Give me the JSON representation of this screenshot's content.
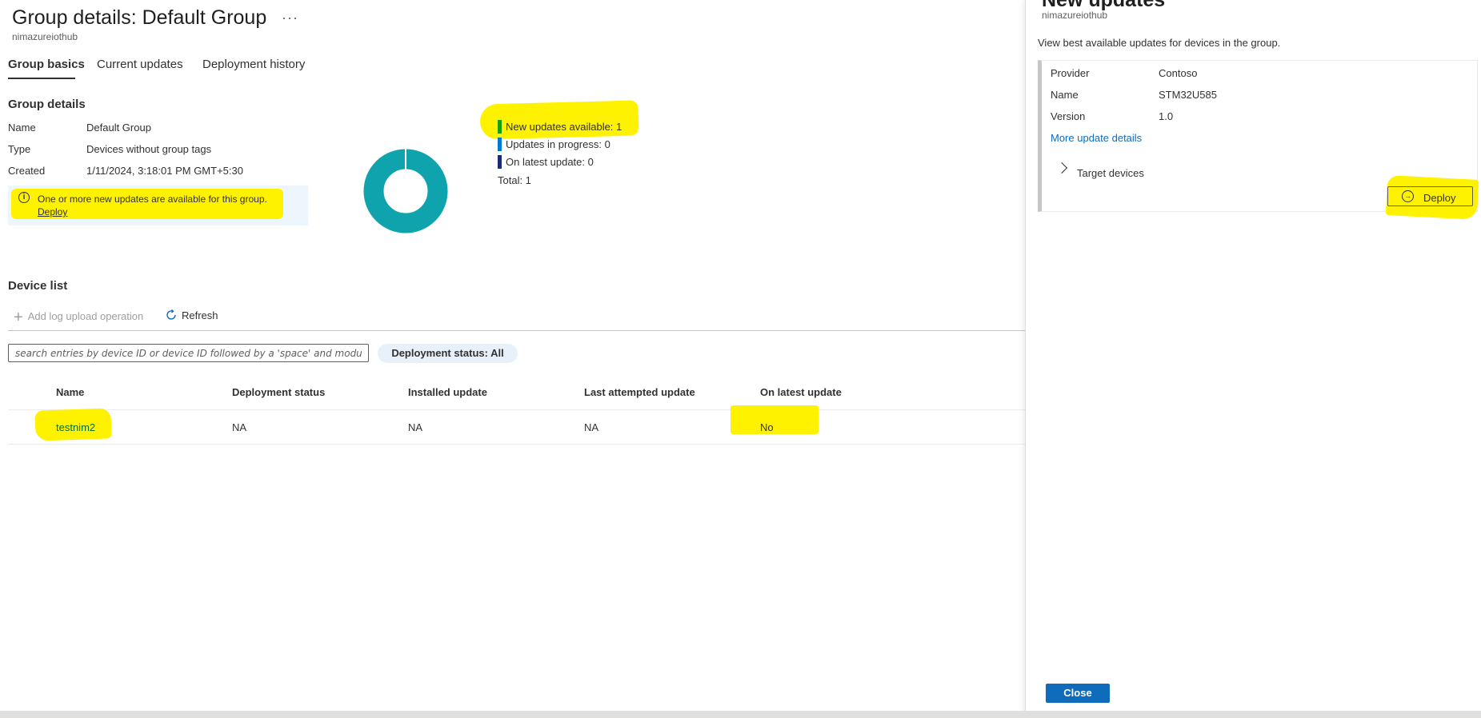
{
  "header": {
    "title": "Group details: Default Group",
    "more_label": "···",
    "subtitle": "nimazureiothub"
  },
  "tabs": [
    {
      "label": "Group basics",
      "active": true
    },
    {
      "label": "Current updates",
      "active": false
    },
    {
      "label": "Deployment history",
      "active": false
    }
  ],
  "group_details": {
    "title": "Group details",
    "rows": [
      {
        "key": "Name",
        "value": "Default Group"
      },
      {
        "key": "Type",
        "value": "Devices without group tags"
      },
      {
        "key": "Created",
        "value": "1/11/2024, 3:18:01 PM GMT+5:30"
      }
    ],
    "info": {
      "icon": "info-icon",
      "text": "One or more new updates are available for this group.",
      "link": "Deploy"
    }
  },
  "status_chart": {
    "legend": [
      {
        "label": "New updates available: 1",
        "value": 1,
        "color": "#13a10e"
      },
      {
        "label": "Updates in progress: 0",
        "value": 0,
        "color": "#0078d4"
      },
      {
        "label": "On latest update: 0",
        "value": 0,
        "color": "#1c2a72"
      }
    ],
    "total_label": "Total: 1",
    "donut_color": "#0fa3ad"
  },
  "device_list": {
    "title": "Device list",
    "toolbar": {
      "add_log": "Add log upload operation",
      "add_icon": "plus-icon",
      "refresh": "Refresh",
      "refresh_icon": "refresh-icon"
    },
    "search_placeholder": "search entries by device ID or device ID followed by a 'space' and module ID.",
    "filter_label": "Deployment status: All",
    "columns": [
      "Name",
      "Deployment status",
      "Installed update",
      "Last attempted update",
      "On latest update"
    ],
    "rows": [
      {
        "name": "testnim2",
        "deployment_status": "NA",
        "installed_update": "NA",
        "last_attempted": "NA",
        "on_latest": "No"
      }
    ]
  },
  "panel": {
    "title": "New updates",
    "subtitle": "nimazureiothub",
    "description": "View best available updates for devices in the group.",
    "update": {
      "rows": [
        {
          "key": "Provider",
          "value": "Contoso"
        },
        {
          "key": "Name",
          "value": "STM32U585"
        },
        {
          "key": "Version",
          "value": "1.0"
        }
      ],
      "details_link": "More update details",
      "target_devices": "Target devices",
      "deploy_label": "Deploy"
    },
    "close_label": "Close"
  },
  "colors": {
    "accent": "#0f6cbd",
    "highlight": "#fff200",
    "donut": "#0fa3ad"
  }
}
